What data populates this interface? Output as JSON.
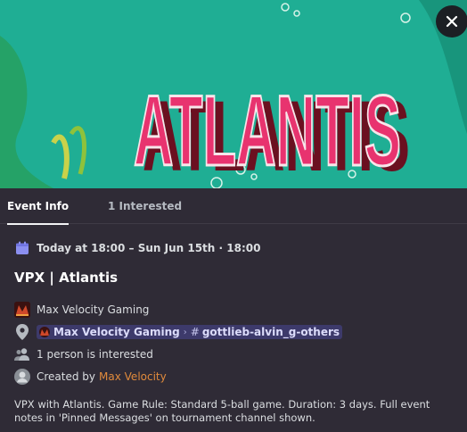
{
  "banner": {
    "art_text": "ATLANTIS",
    "colors": {
      "sea": "#1fae94",
      "letters": "#e8336f",
      "outline": "#a01d2a"
    }
  },
  "close": {
    "icon": "close-icon"
  },
  "tabs": [
    {
      "label": "Event Info",
      "active": true
    },
    {
      "label": "1 Interested",
      "active": false
    }
  ],
  "event": {
    "datetime": "Today at 18:00 – Sun Jun 15th · 18:00",
    "title": "VPX | Atlantis",
    "host": "Max Velocity Gaming",
    "location": {
      "server": "Max Velocity Gaming",
      "separator": "›",
      "channel_prefix": "#",
      "channel": "gottlieb-alvin_g-others"
    },
    "interested": "1 person is interested",
    "created_by_label": "Created by",
    "created_by_name": "Max Velocity",
    "description": "VPX with Atlantis. Game Rule: Standard 5-ball game. Duration: 3 days. Full event notes in 'Pinned Messages' on tournament channel shown."
  },
  "colors": {
    "background": "#2f2b36",
    "calendar_icon": "#8b8ff0",
    "creator_link": "#e08a3c",
    "channel_chip": "#3d3a6b"
  }
}
